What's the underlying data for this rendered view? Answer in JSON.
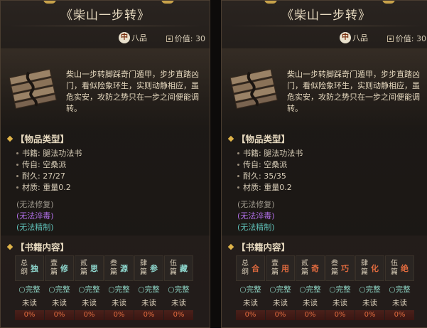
{
  "colors": {
    "skill_teal": "#8fd8cf",
    "skill_orange": "#e06a3e",
    "complete": "#8fd8c8"
  },
  "panels": [
    {
      "title": "《柴山一步转》",
      "grade_badge": "中",
      "grade": "八品",
      "value_label": "价值: 30",
      "icon": "scroll-wood-icon",
      "description": "柴山一步转脚踩奇门遁甲，步步直踏凶门，看似险象环生，实则动静相应，虽危实安，攻防之势只在一步之间便能调转。",
      "type_header": "【物品类型】",
      "attributes": [
        "书籍: 腿法功法书",
        "传自: 空桑派",
        "耐久: 27/27",
        "材质: 重量0.2"
      ],
      "statuses": [
        "(无法修复)",
        "(无法淬毒)",
        "(无法精制)"
      ],
      "book_header": "【书籍内容】",
      "chapters": [
        {
          "name": "总纲",
          "skill": "独",
          "status": "○完整",
          "read": "未读",
          "progress": "0%"
        },
        {
          "name": "壹篇",
          "skill": "修",
          "status": "○完整",
          "read": "未读",
          "progress": "0%"
        },
        {
          "name": "贰篇",
          "skill": "思",
          "status": "○完整",
          "read": "未读",
          "progress": "0%"
        },
        {
          "name": "叁篇",
          "skill": "源",
          "status": "○完整",
          "read": "未读",
          "progress": "0%"
        },
        {
          "name": "肆篇",
          "skill": "参",
          "status": "○完整",
          "read": "未读",
          "progress": "0%"
        },
        {
          "name": "伍篇",
          "skill": "藏",
          "status": "○完整",
          "read": "未读",
          "progress": "0%"
        }
      ]
    },
    {
      "title": "《柴山一步转》",
      "grade_badge": "中",
      "grade": "八品",
      "value_label": "价值: 30",
      "icon": "scroll-wood-icon",
      "description": "柴山一步转脚踩奇门遁甲，步步直踏凶门，看似险象环生，实则动静相应，虽危实安，攻防之势只在一步之间便能调转。",
      "type_header": "【物品类型】",
      "attributes": [
        "书籍: 腿法功法书",
        "传自: 空桑派",
        "耐久: 35/35",
        "材质: 重量0.2"
      ],
      "statuses": [
        "(无法修复)",
        "(无法淬毒)",
        "(无法精制)"
      ],
      "book_header": "【书籍内容】",
      "chapters": [
        {
          "name": "总纲",
          "skill": "合",
          "status": "○完整",
          "read": "未读",
          "progress": "0%"
        },
        {
          "name": "壹篇",
          "skill": "用",
          "status": "○完整",
          "read": "未读",
          "progress": "0%"
        },
        {
          "name": "贰篇",
          "skill": "奇",
          "status": "○完整",
          "read": "未读",
          "progress": "0%"
        },
        {
          "name": "叁篇",
          "skill": "巧",
          "status": "○完整",
          "read": "未读",
          "progress": "0%"
        },
        {
          "name": "肆篇",
          "skill": "化",
          "status": "○完整",
          "read": "未读",
          "progress": "0%"
        },
        {
          "name": "伍篇",
          "skill": "绝",
          "status": "○完整",
          "read": "未读",
          "progress": "0%"
        }
      ]
    }
  ]
}
